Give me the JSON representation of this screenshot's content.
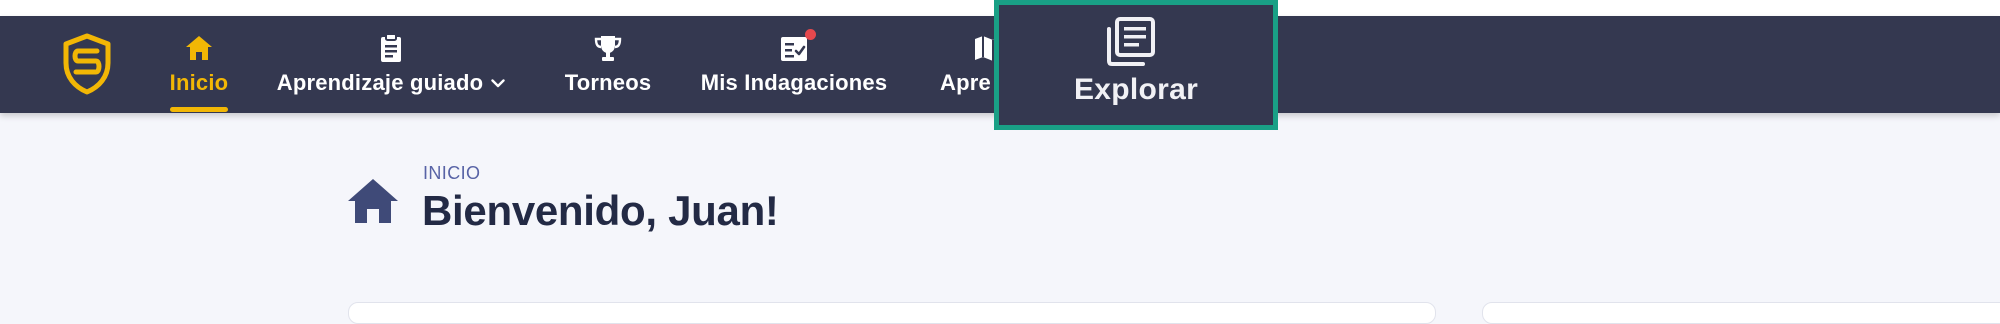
{
  "navbar": {
    "logo": "shield-s-logo",
    "items": [
      {
        "label": "Inicio",
        "icon": "home-icon",
        "active": true
      },
      {
        "label": "Aprendizaje guiado",
        "icon": "clipboard-icon",
        "dropdown": true
      },
      {
        "label": "Torneos",
        "icon": "trophy-icon"
      },
      {
        "label": "Mis Indagaciones",
        "icon": "checklist-icon",
        "notification": true
      },
      {
        "label": "Apre",
        "icon": "map-icon"
      }
    ],
    "highlighted": {
      "label": "Explorar",
      "icon": "library-icon"
    }
  },
  "main": {
    "breadcrumb": "INICIO",
    "title": "Bienvenido, Juan!"
  },
  "colors": {
    "navbar_bg": "#343850",
    "accent": "#f2b705",
    "highlight_border": "#19a086",
    "page_bg": "#f5f6fb",
    "title": "#232a45",
    "breadcrumb": "#5863a6",
    "notification": "#e5484d"
  }
}
